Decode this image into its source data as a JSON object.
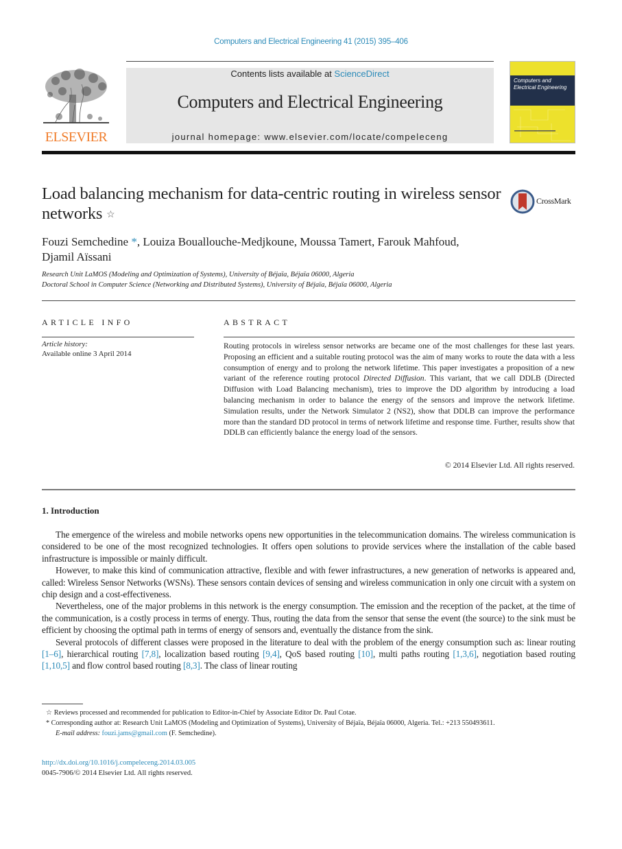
{
  "header": {
    "journal_reference": "Computers and Electrical Engineering 41 (2015) 395–406",
    "contents_prefix": "Contents lists available at ",
    "contents_link": "ScienceDirect",
    "journal_title": "Computers and Electrical Engineering",
    "homepage": "journal homepage: www.elsevier.com/locate/compeleceng",
    "publisher_logo_text": "ELSEVIER",
    "cover_title_line1": "Computers and",
    "cover_title_line2": "Electrical Engineering",
    "crossmark_label": "CrossMark"
  },
  "article": {
    "title": "Load balancing mechanism for data-centric routing in wireless sensor networks",
    "title_note_marker": "☆",
    "authors": [
      {
        "name": "Fouzi Semchedine",
        "marker": "*"
      },
      {
        "name": "Louiza Bouallouche-Medjkoune"
      },
      {
        "name": "Moussa Tamert"
      },
      {
        "name": "Farouk Mahfoud"
      },
      {
        "name": "Djamil Aïssani"
      }
    ],
    "author_line1_a": "Fouzi Semchedine ",
    "author_line1_marker": "*",
    "author_line1_b": ", Louiza Bouallouche-Medjkoune, Moussa Tamert, Farouk Mahfoud,",
    "author_line2": "Djamil Aïssani",
    "affiliations": [
      "Research Unit LaMOS (Modeling and Optimization of Systems), University of Béjaïa, Béjaïa 06000, Algeria",
      "Doctoral School in Computer Science (Networking and Distributed Systems), University of Béjaïa, Béjaïa 06000, Algeria"
    ]
  },
  "article_info": {
    "heading": "ARTICLE INFO",
    "history_label": "Article history:",
    "history_value": "Available online 3 April 2014"
  },
  "abstract": {
    "heading": "ABSTRACT",
    "text_part1": "Routing protocols in wireless sensor networks are became one of the most challenges for these last years. Proposing an efficient and a suitable routing protocol was the aim of many works to route the data with a less consumption of energy and to prolong the network lifetime. This paper investigates a proposition of a new variant of the reference routing protocol ",
    "text_italic": "Directed Diffusion",
    "text_part2": ". This variant, that we call DDLB (Directed Diffusion with Load Balancing mechanism), tries to improve the DD algorithm by introducing a load balancing mechanism in order to balance the energy of the sensors and improve the network lifetime. Simulation results, under the Network Simulator 2 (NS2), show that DDLB can improve the performance more than the standard DD protocol in terms of network lifetime and response time. Further, results show that DDLB can efficiently balance the energy load of the sensors.",
    "copyright": "© 2014 Elsevier Ltd. All rights reserved."
  },
  "introduction": {
    "heading": "1. Introduction",
    "paragraphs": [
      "The emergence of the wireless and mobile networks opens new opportunities in the telecommunication domains. The wireless communication is considered to be one of the most recognized technologies. It offers open solutions to provide services where the installation of the cable based infrastructure is impossible or mainly difficult.",
      "However, to make this kind of communication attractive, flexible and with fewer infrastructures, a new generation of networks is appeared and, called: Wireless Sensor Networks (WSNs). These sensors contain devices of sensing and wireless communication in only one circuit with a system on chip design and a cost-effectiveness.",
      "Nevertheless, one of the major problems in this network is the energy consumption. The emission and the reception of the packet, at the time of the communication, is a costly process in terms of energy. Thus, routing the data from the sensor that sense the event (the source) to the sink must be efficient by choosing the optimal path in terms of energy of sensors and, eventually the distance from the sink."
    ],
    "p4_segments": [
      {
        "text": "Several protocols of different classes were proposed in the literature to deal with the problem of the energy consumption such as: linear routing "
      },
      {
        "text": "[1–6]",
        "link": true
      },
      {
        "text": ", hierarchical routing "
      },
      {
        "text": "[7,8]",
        "link": true
      },
      {
        "text": ", localization based routing "
      },
      {
        "text": "[9,4]",
        "link": true
      },
      {
        "text": ", QoS based routing "
      },
      {
        "text": "[10]",
        "link": true
      },
      {
        "text": ", multi paths routing "
      },
      {
        "text": "[1,3,6]",
        "link": true
      },
      {
        "text": ", negotiation based routing "
      },
      {
        "text": "[1,10,5]",
        "link": true
      },
      {
        "text": " and flow control based routing "
      },
      {
        "text": "[8,3]",
        "link": true
      },
      {
        "text": ". The class of linear routing"
      }
    ]
  },
  "footnotes": {
    "note1_marker": "☆",
    "note1": " Reviews processed and recommended for publication to Editor-in-Chief by Associate Editor Dr. Paul Cotae.",
    "note2_marker": "*",
    "note2": " Corresponding author at: Research Unit LaMOS (Modeling and Optimization of Systems), University of Béjaïa, Béjaïa 06000, Algeria. Tel.: +213 550493611.",
    "email_label": "E-mail address:",
    "email": "fouzi.jams@gmail.com",
    "email_suffix": " (F. Semchedine).",
    "doi": "http://dx.doi.org/10.1016/j.compeleceng.2014.03.005",
    "issn_copyright": "0045-7906/© 2014 Elsevier Ltd. All rights reserved."
  },
  "colors": {
    "link": "#2a8ab8",
    "elsevier_orange": "#f07c2a",
    "header_band": "#e6e6e6",
    "cover_yellow": "#ede12c",
    "cover_navy": "#22304a",
    "crossmark_red": "#c0392b"
  }
}
